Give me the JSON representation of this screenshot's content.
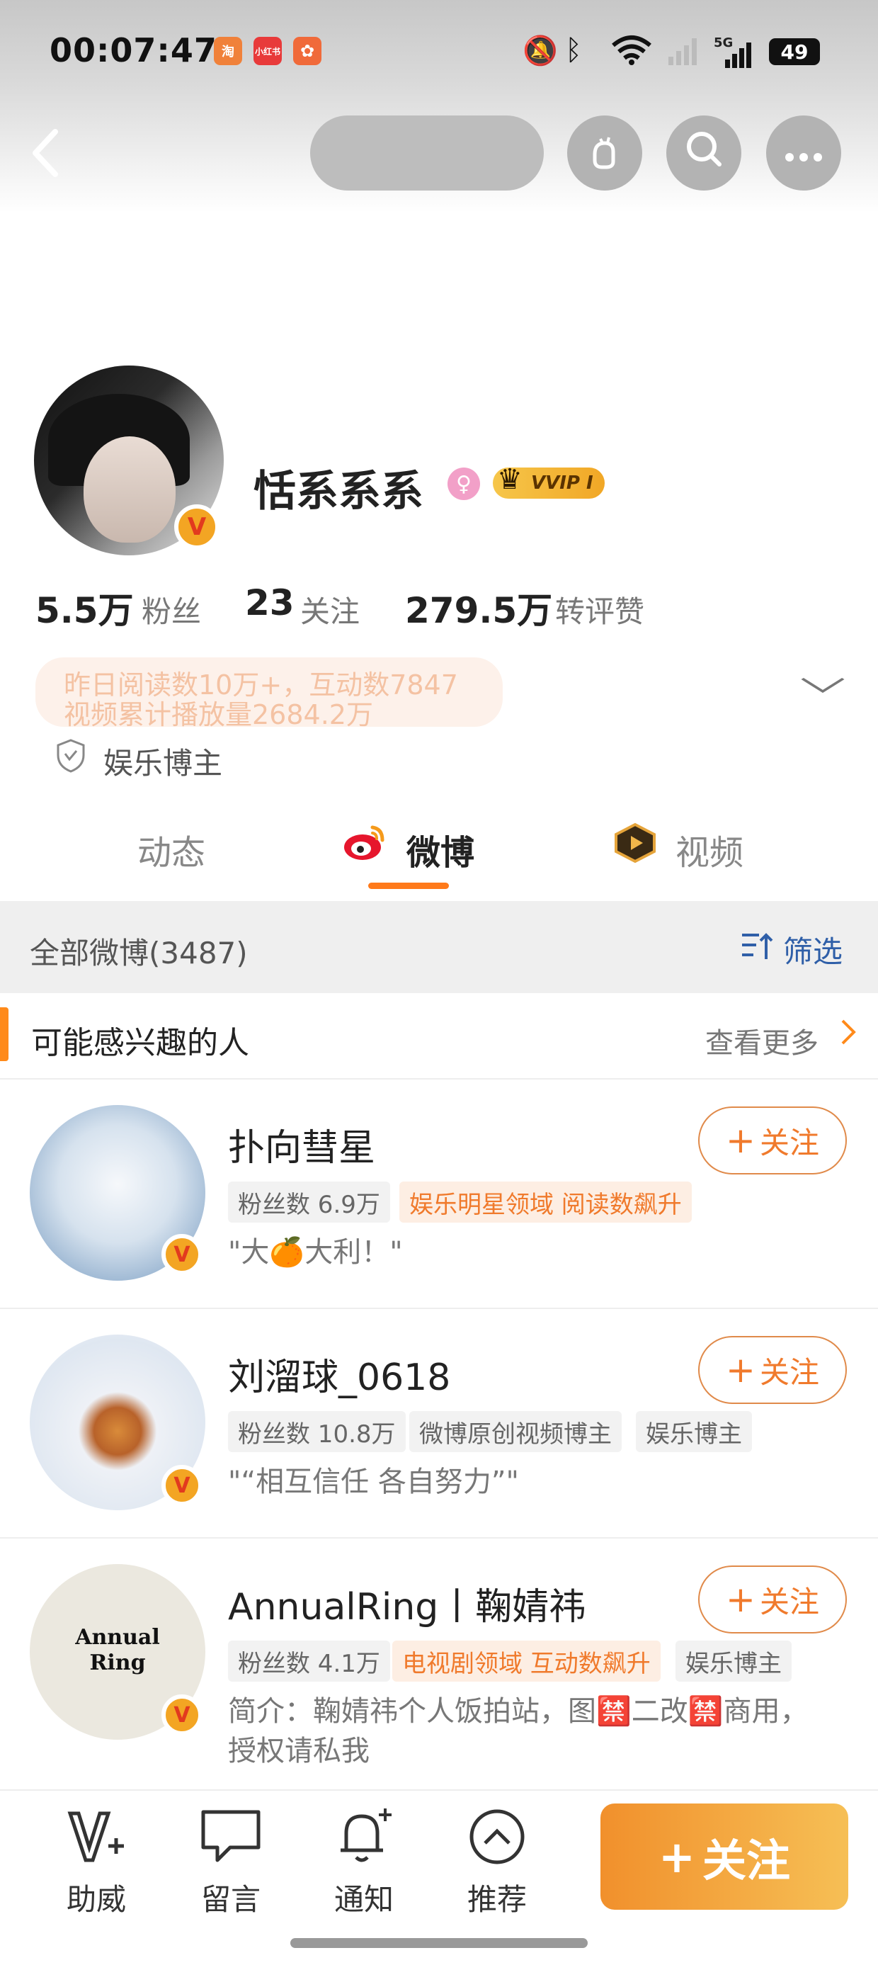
{
  "status_bar": {
    "time": "00:07:47",
    "apps": [
      "淘",
      "小红书",
      "✿"
    ],
    "battery": "49",
    "network": "5G"
  },
  "nav": {
    "back_icon": "chevron-left-icon",
    "actions": [
      "gesture-icon",
      "search-icon",
      "more-icon"
    ]
  },
  "profile": {
    "name": "恬系系系",
    "vip_label": "VVIP Ⅰ",
    "gender": "♀",
    "stats": [
      {
        "num": "5.5万",
        "label": "粉丝"
      },
      {
        "num": "23",
        "label": "关注"
      },
      {
        "num": "279.5万",
        "label": "转评赞"
      }
    ],
    "highlight_lines": [
      "昨日阅读数10万+，互动数7847",
      "视频累计播放量2684.2万"
    ],
    "certification": "娱乐博主"
  },
  "tabs": [
    {
      "label": "动态",
      "active": false
    },
    {
      "label": "微博",
      "active": true
    },
    {
      "label": "视频",
      "active": false
    }
  ],
  "filter": {
    "title": "全部微博(3487)",
    "button": "筛选"
  },
  "interest": {
    "title": "可能感兴趣的人",
    "more": "查看更多"
  },
  "recommendations": [
    {
      "name": "扑向彗星",
      "badges": [
        {
          "text": "粉丝数 6.9万",
          "style": "gray"
        },
        {
          "text": "娱乐明星领域 阅读数飙升",
          "style": "orange"
        }
      ],
      "desc": [
        "\"大🍊大利！\""
      ],
      "follow": "关注"
    },
    {
      "name": "刘溜球_0618",
      "badges": [
        {
          "text": "粉丝数 10.8万",
          "style": "gray"
        },
        {
          "text": "微博原创视频博主",
          "style": "gray"
        },
        {
          "text": "娱乐博主",
          "style": "gray"
        }
      ],
      "desc": [
        "\"“相互信任 各自努力”\""
      ],
      "follow": "关注"
    },
    {
      "name": "AnnualRing丨鞠婧祎",
      "badges": [
        {
          "text": "粉丝数 4.1万",
          "style": "gray"
        },
        {
          "text": "电视剧领域 互动数飙升",
          "style": "orange"
        },
        {
          "text": "娱乐博主",
          "style": "gray"
        }
      ],
      "desc": [
        "简介：鞠婧祎个人饭拍站，图🈲二改🈲商用，",
        "授权请私我"
      ],
      "follow": "关注",
      "avatar_text": [
        "Annual",
        "Ring"
      ]
    }
  ],
  "bottom_bar": {
    "items": [
      {
        "label": "助威",
        "icon": "cheer-icon"
      },
      {
        "label": "留言",
        "icon": "message-icon"
      },
      {
        "label": "通知",
        "icon": "bell-icon"
      },
      {
        "label": "推荐",
        "icon": "recommend-icon"
      }
    ],
    "follow_label": "关注"
  },
  "colors": {
    "accent": "#ff7a1a",
    "link": "#2f5fa8",
    "follow_gradient": [
      "#f1902c",
      "#f6bf55"
    ]
  }
}
